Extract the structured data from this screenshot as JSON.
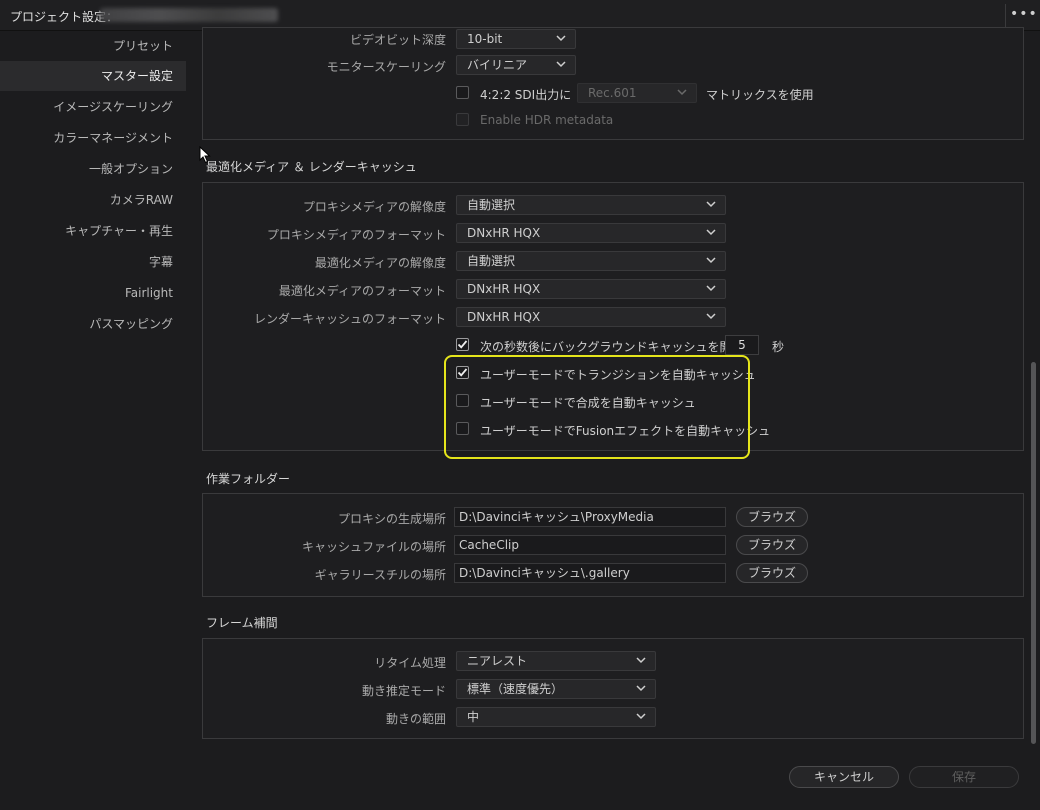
{
  "window": {
    "title": "プロジェクト設定：",
    "more_icon": "ellipsis-icon"
  },
  "sidebar": {
    "items": [
      {
        "label": "プリセット"
      },
      {
        "label": "マスター設定",
        "active": true
      },
      {
        "label": "イメージスケーリング"
      },
      {
        "label": "カラーマネージメント"
      },
      {
        "label": "一般オプション"
      },
      {
        "label": "カメラRAW"
      },
      {
        "label": "キャプチャー・再生"
      },
      {
        "label": "字幕"
      },
      {
        "label": "Fairlight"
      },
      {
        "label": "パスマッピング"
      }
    ]
  },
  "video": {
    "bit_depth": {
      "label": "ビデオビット深度",
      "value": "10-bit"
    },
    "monitor_scaling": {
      "label": "モニタースケーリング",
      "value": "バイリニア"
    },
    "sdi": {
      "label": "4:2:2 SDI出力に",
      "matrix": "Rec.601",
      "suffix": "マトリックスを使用",
      "checked": false
    },
    "hdr": {
      "label": "Enable HDR metadata",
      "checked": false
    }
  },
  "cache": {
    "title": "最適化メディア ＆ レンダーキャッシュ",
    "proxy_resolution": {
      "label": "プロキシメディアの解像度",
      "value": "自動選択"
    },
    "proxy_format": {
      "label": "プロキシメディアのフォーマット",
      "value": "DNxHR HQX"
    },
    "optimized_resolution": {
      "label": "最適化メディアの解像度",
      "value": "自動選択"
    },
    "optimized_format": {
      "label": "最適化メディアのフォーマット",
      "value": "DNxHR HQX"
    },
    "render_cache_format": {
      "label": "レンダーキャッシュのフォーマット",
      "value": "DNxHR HQX"
    },
    "background_cache": {
      "label": "次の秒数後にバックグラウンドキャッシュを開始",
      "seconds": "5",
      "unit": "秒",
      "checked": true
    },
    "auto_transitions": {
      "label": "ユーザーモードでトランジションを自動キャッシュ",
      "checked": true
    },
    "auto_composites": {
      "label": "ユーザーモードで合成を自動キャッシュ",
      "checked": false
    },
    "auto_fusion": {
      "label": "ユーザーモードでFusionエフェクトを自動キャッシュ",
      "checked": false
    },
    "highlight_color": "#e5e51b"
  },
  "folders": {
    "title": "作業フォルダー",
    "proxy": {
      "label": "プロキシの生成場所",
      "value": "D:\\Davinciキャッシュ\\ProxyMedia",
      "button": "ブラウズ"
    },
    "cache_files": {
      "label": "キャッシュファイルの場所",
      "value": "CacheClip",
      "button": "ブラウズ"
    },
    "gallery": {
      "label": "ギャラリースチルの場所",
      "value": "D:\\Davinciキャッシュ\\.gallery",
      "button": "ブラウズ"
    }
  },
  "interpolation": {
    "title": "フレーム補間",
    "retime": {
      "label": "リタイム処理",
      "value": "ニアレスト"
    },
    "motion_mode": {
      "label": "動き推定モード",
      "value": "標準（速度優先）"
    },
    "motion_range": {
      "label": "動きの範囲",
      "value": "中"
    }
  },
  "footer": {
    "cancel": "キャンセル",
    "save": "保存"
  }
}
